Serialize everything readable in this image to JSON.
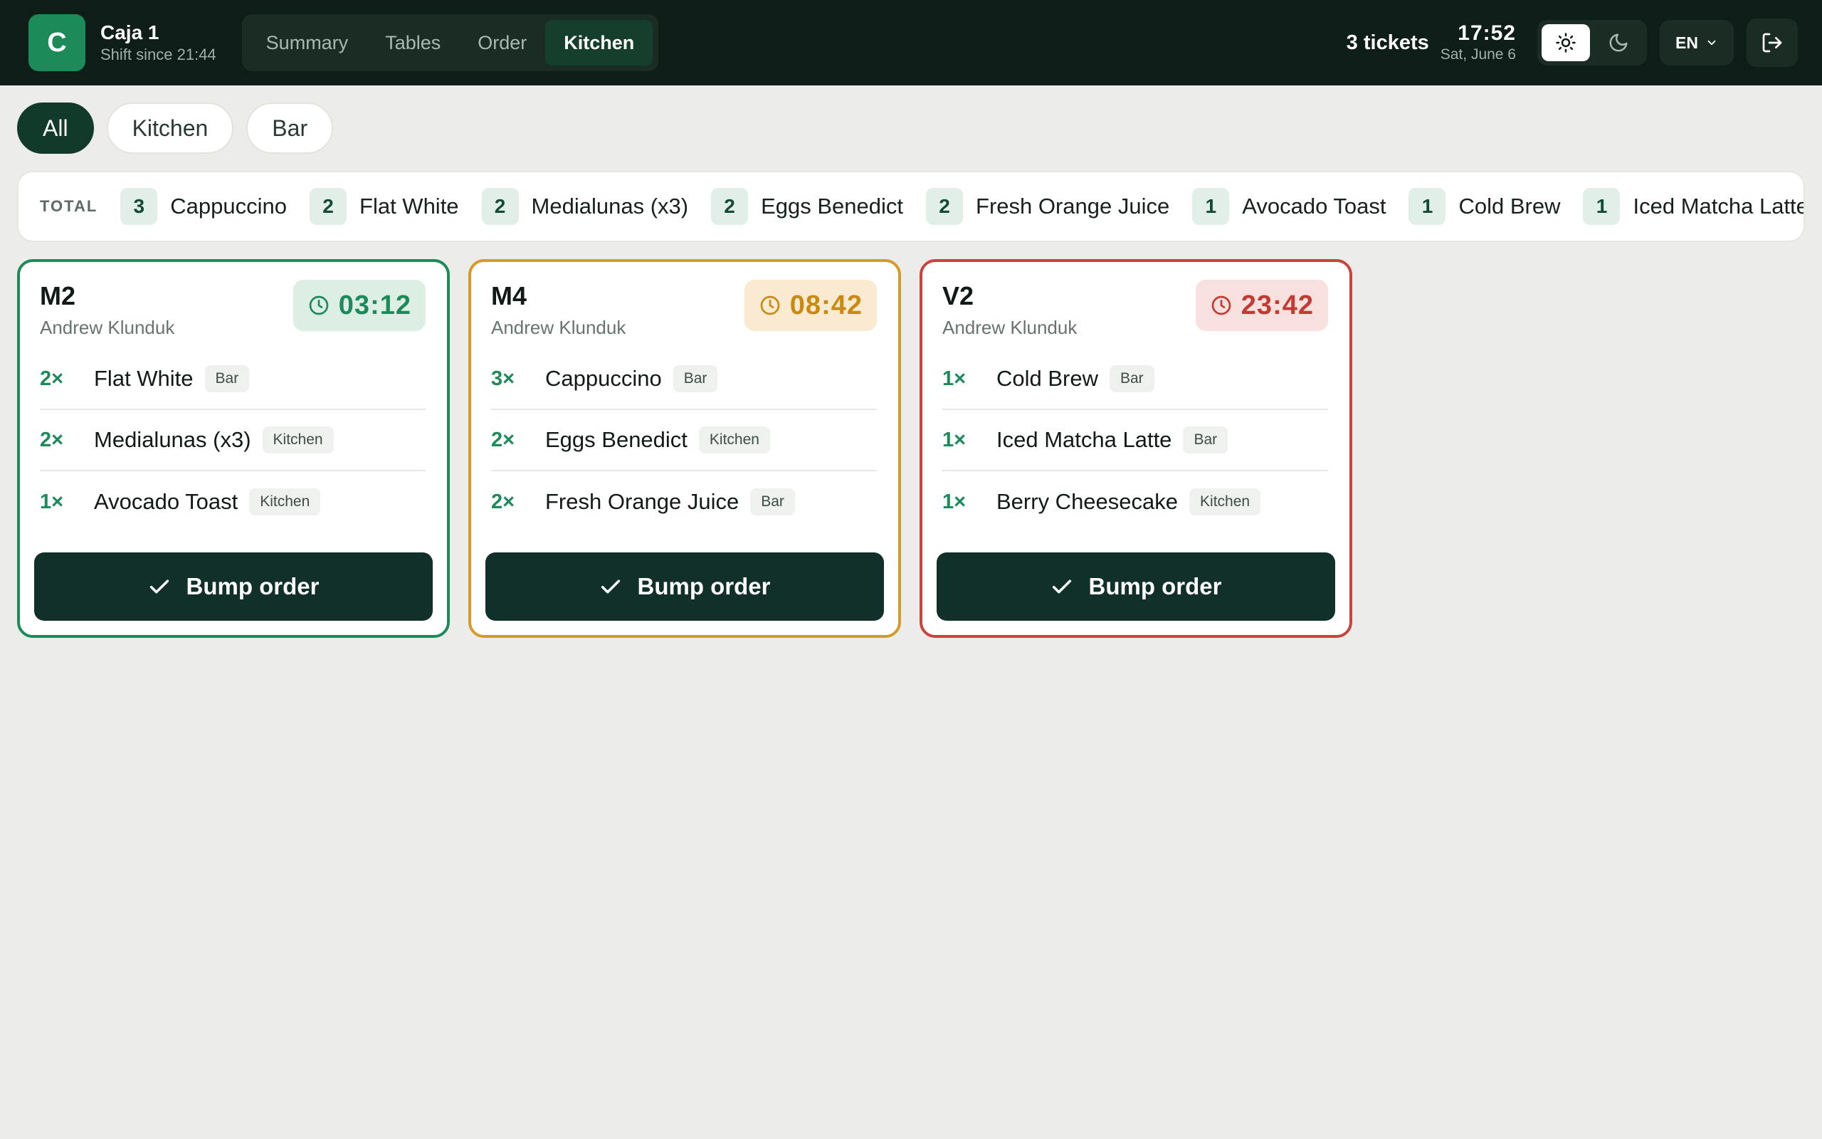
{
  "header": {
    "logo_letter": "C",
    "register_name": "Caja 1",
    "shift_text": "Shift since 21:44",
    "nav_tabs": [
      {
        "label": "Summary",
        "active": false
      },
      {
        "label": "Tables",
        "active": false
      },
      {
        "label": "Order",
        "active": false
      },
      {
        "label": "Kitchen",
        "active": true
      }
    ],
    "ticket_count": "3 tickets",
    "time": "17:52",
    "date": "Sat, June 6",
    "theme": {
      "light_icon": "sun-icon",
      "dark_icon": "moon-icon",
      "active": "light"
    },
    "language": "EN",
    "logout_icon": "logout-icon"
  },
  "filters": [
    {
      "label": "All",
      "active": true
    },
    {
      "label": "Kitchen",
      "active": false
    },
    {
      "label": "Bar",
      "active": false
    }
  ],
  "totals": {
    "label": "TOTAL",
    "items": [
      {
        "qty": "3",
        "name": "Cappuccino"
      },
      {
        "qty": "2",
        "name": "Flat White"
      },
      {
        "qty": "2",
        "name": "Medialunas (x3)"
      },
      {
        "qty": "2",
        "name": "Eggs Benedict"
      },
      {
        "qty": "2",
        "name": "Fresh Orange Juice"
      },
      {
        "qty": "1",
        "name": "Avocado Toast"
      },
      {
        "qty": "1",
        "name": "Cold Brew"
      },
      {
        "qty": "1",
        "name": "Iced Matcha Latte"
      }
    ]
  },
  "tickets": [
    {
      "table": "M2",
      "waiter": "Andrew Klunduk",
      "timer": "03:12",
      "status": "ok",
      "items": [
        {
          "qty": "2×",
          "name": "Flat White",
          "station": "Bar"
        },
        {
          "qty": "2×",
          "name": "Medialunas (x3)",
          "station": "Kitchen"
        },
        {
          "qty": "1×",
          "name": "Avocado Toast",
          "station": "Kitchen"
        }
      ],
      "bump_label": "Bump order"
    },
    {
      "table": "M4",
      "waiter": "Andrew Klunduk",
      "timer": "08:42",
      "status": "warn",
      "items": [
        {
          "qty": "3×",
          "name": "Cappuccino",
          "station": "Bar"
        },
        {
          "qty": "2×",
          "name": "Eggs Benedict",
          "station": "Kitchen"
        },
        {
          "qty": "2×",
          "name": "Fresh Orange Juice",
          "station": "Bar"
        }
      ],
      "bump_label": "Bump order"
    },
    {
      "table": "V2",
      "waiter": "Andrew Klunduk",
      "timer": "23:42",
      "status": "late",
      "items": [
        {
          "qty": "1×",
          "name": "Cold Brew",
          "station": "Bar"
        },
        {
          "qty": "1×",
          "name": "Iced Matcha Latte",
          "station": "Bar"
        },
        {
          "qty": "1×",
          "name": "Berry Cheesecake",
          "station": "Kitchen"
        }
      ],
      "bump_label": "Bump order"
    }
  ],
  "colors": {
    "topbar": "#0e1d17",
    "accent_green": "#1d8a5a",
    "status_warn": "#d59a2a",
    "status_late": "#c8443d",
    "button_dark": "#12302a",
    "background": "#ecedea"
  }
}
